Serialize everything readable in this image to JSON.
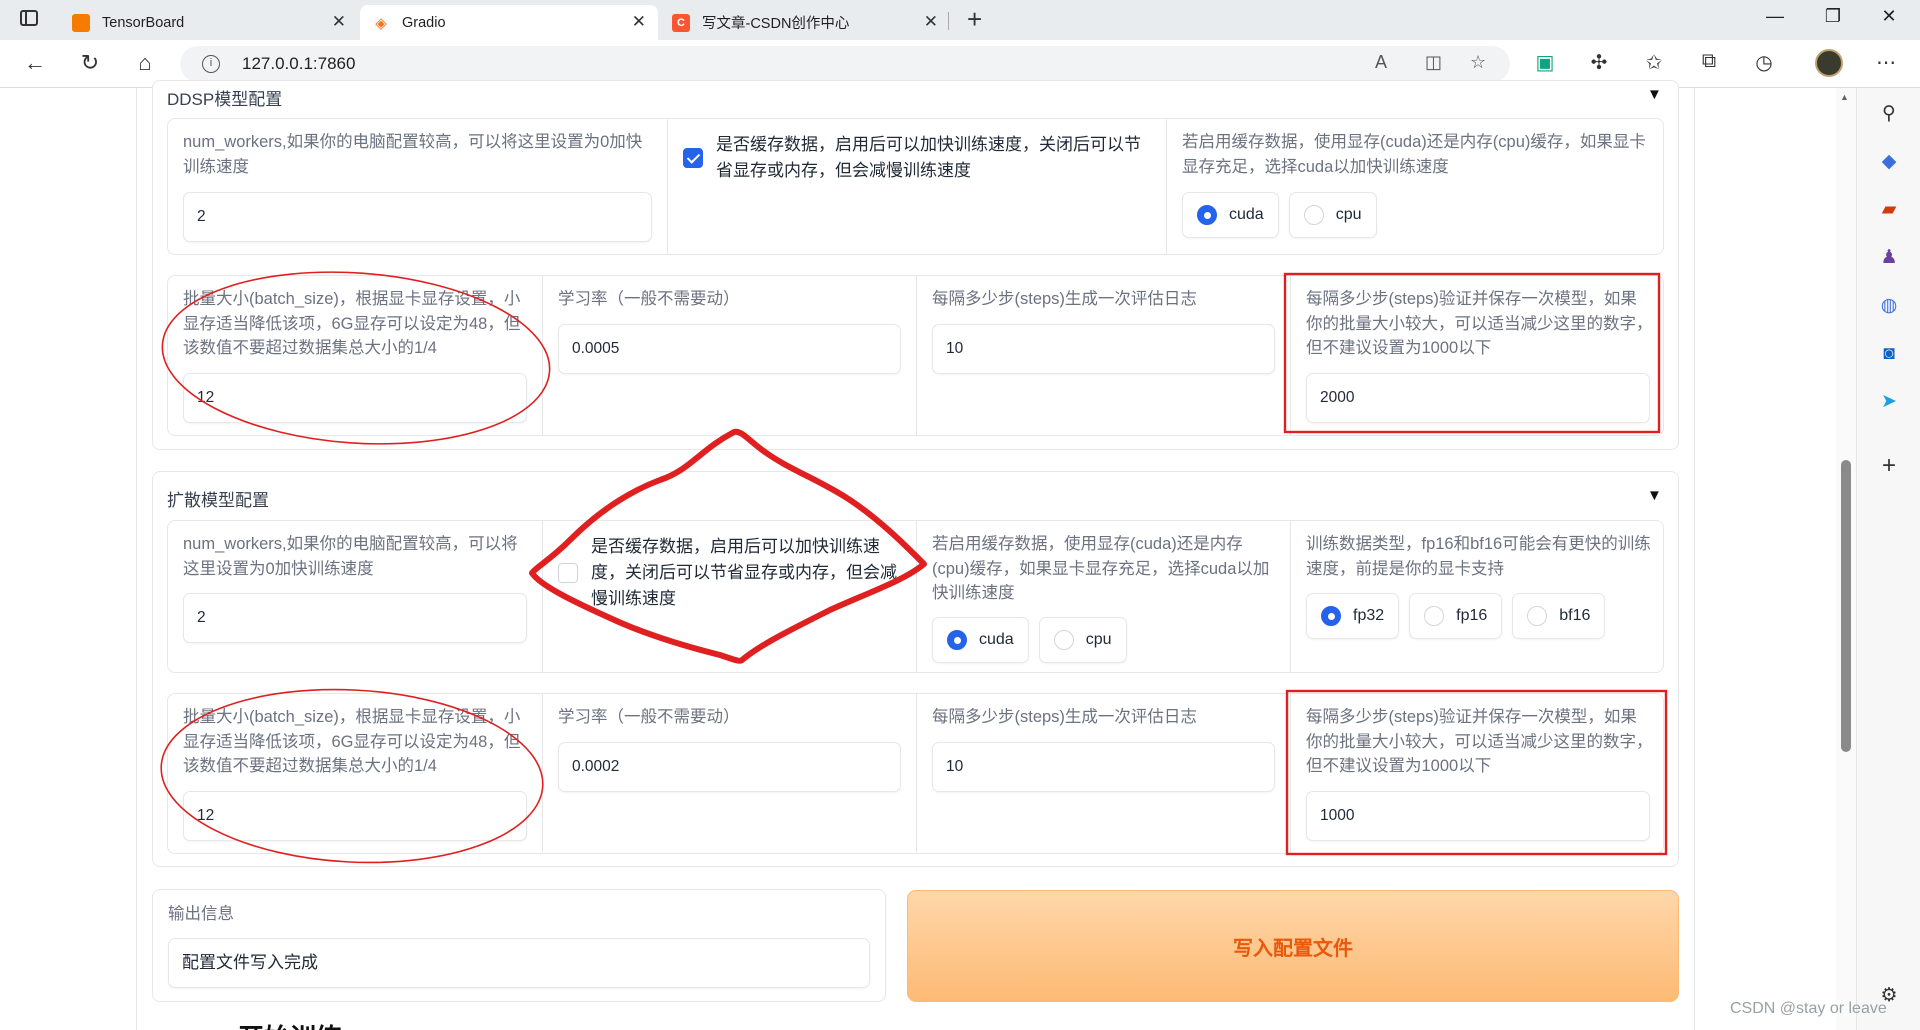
{
  "browser": {
    "tabs": [
      {
        "title": "TensorBoard",
        "active": false,
        "color": "#f57c00"
      },
      {
        "title": "Gradio",
        "active": true,
        "color": "#f97316"
      },
      {
        "title": "写文章-CSDN创作中心",
        "active": false,
        "color": "#fc5531",
        "favicon_text": "C"
      }
    ],
    "url": "127.0.0.1:7860"
  },
  "ddsp": {
    "title": "DDSP模型配置",
    "num_workers": {
      "label": "num_workers,如果你的电脑配置较高，可以将这里设置为0加快训练速度",
      "value": "2"
    },
    "cache": {
      "label": "是否缓存数据，启用后可以加快训练速度，关闭后可以节省显存或内存，但会减慢训练速度",
      "checked": true
    },
    "cache_device": {
      "label": "若启用缓存数据，使用显存(cuda)还是内存(cpu)缓存，如果显卡显存充足，选择cuda以加快训练速度",
      "options": [
        "cuda",
        "cpu"
      ],
      "selected": "cuda"
    },
    "batch_size": {
      "label": "批量大小(batch_size)，根据显卡显存设置，小显存适当降低该项，6G显存可以设定为48，但该数值不要超过数据集总大小的1/4",
      "value": "12"
    },
    "learning_rate": {
      "label": "学习率（一般不需要动）",
      "value": "0.0005"
    },
    "log_interval": {
      "label": "每隔多少步(steps)生成一次评估日志",
      "value": "10"
    },
    "save_interval": {
      "label": "每隔多少步(steps)验证并保存一次模型，如果你的批量大小较大，可以适当减少这里的数字，但不建议设置为1000以下",
      "value": "2000"
    }
  },
  "diffusion": {
    "title": "扩散模型配置",
    "num_workers": {
      "label": "num_workers,如果你的电脑配置较高，可以将这里设置为0加快训练速度",
      "value": "2"
    },
    "cache": {
      "label": "是否缓存数据，启用后可以加快训练速度，关闭后可以节省显存或内存，但会减慢训练速度",
      "checked": false
    },
    "cache_device": {
      "label": "若启用缓存数据，使用显存(cuda)还是内存(cpu)缓存，如果显卡显存充足，选择cuda以加快训练速度",
      "options": [
        "cuda",
        "cpu"
      ],
      "selected": "cuda"
    },
    "dtype": {
      "label": "训练数据类型，fp16和bf16可能会有更快的训练速度，前提是你的显卡支持",
      "options": [
        "fp32",
        "fp16",
        "bf16"
      ],
      "selected": "fp32"
    },
    "batch_size": {
      "label": "批量大小(batch_size)，根据显卡显存设置，小显存适当降低该项，6G显存可以设定为48，但该数值不要超过数据集总大小的1/4",
      "value": "12"
    },
    "learning_rate": {
      "label": "学习率（一般不需要动）",
      "value": "0.0002"
    },
    "log_interval": {
      "label": "每隔多少步(steps)生成一次评估日志",
      "value": "10"
    },
    "save_interval": {
      "label": "每隔多少步(steps)验证并保存一次模型，如果你的批量大小较大，可以适当减少这里的数字，但不建议设置为1000以下",
      "value": "1000"
    }
  },
  "output": {
    "label": "输出信息",
    "value": "配置文件写入完成"
  },
  "write_button": "写入配置文件",
  "partial_heading": "开始训练",
  "watermark": "CSDN @stay or leave",
  "colors": {
    "accent": "#2563eb",
    "button_text": "#ea580c",
    "annotation": "#e02020"
  }
}
